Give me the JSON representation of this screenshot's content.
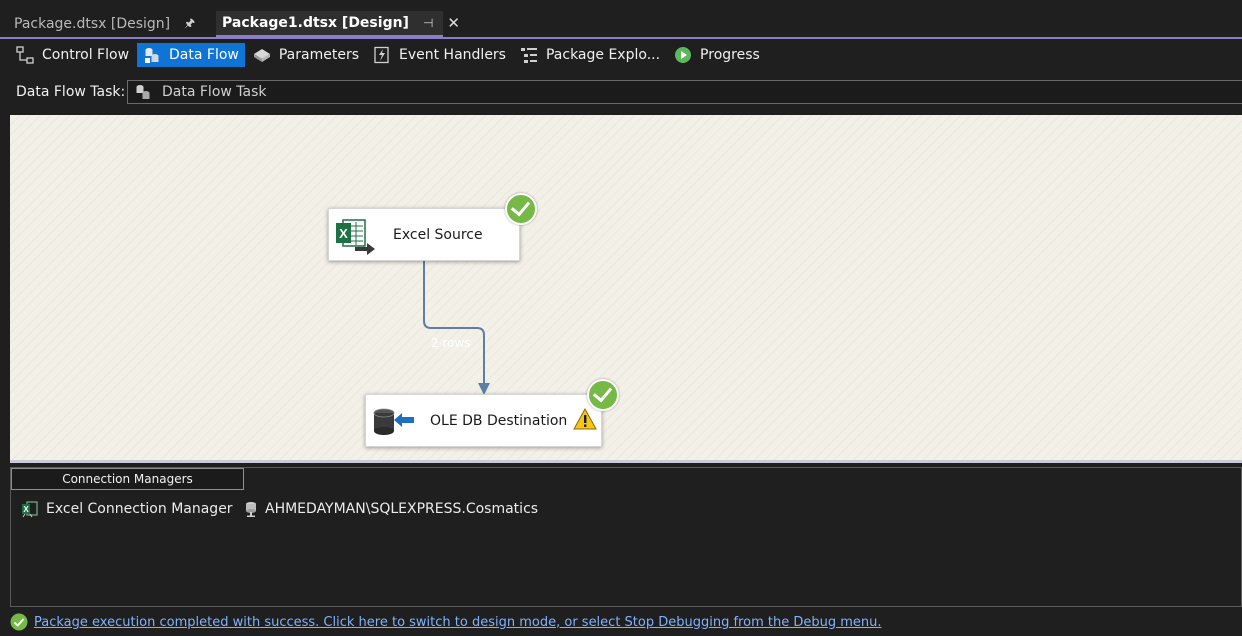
{
  "tabs": [
    {
      "label": "Package.dtsx [Design]",
      "active": false
    },
    {
      "label": "Package1.dtsx [Design]",
      "active": true
    }
  ],
  "toolbar": {
    "items": [
      {
        "label": "Control Flow",
        "icon": "control-flow-icon",
        "active": false
      },
      {
        "label": "Data Flow",
        "icon": "data-flow-icon",
        "active": true
      },
      {
        "label": "Parameters",
        "icon": "parameters-icon",
        "active": false
      },
      {
        "label": "Event Handlers",
        "icon": "event-handlers-icon",
        "active": false
      },
      {
        "label": "Package Explo...",
        "icon": "package-explorer-icon",
        "active": false
      },
      {
        "label": "Progress",
        "icon": "progress-icon",
        "active": false
      }
    ]
  },
  "task": {
    "label": "Data Flow Task:",
    "value": "Data Flow Task"
  },
  "canvas": {
    "components": [
      {
        "label": "Excel Source",
        "icon": "excel-source-icon",
        "status": "success"
      },
      {
        "label": "OLE DB Destination",
        "icon": "ole-db-destination-icon",
        "status": "success",
        "warning": true
      }
    ],
    "path_label": "2 rows"
  },
  "connection_managers": {
    "tab_label": "Connection Managers",
    "items": [
      {
        "label": "Excel Connection Manager",
        "icon": "excel-connection-icon"
      },
      {
        "label": "AHMEDAYMAN\\SQLEXPRESS.Cosmatics",
        "icon": "oledb-connection-icon"
      }
    ]
  },
  "status": {
    "text": "Package execution completed with success. Click here to switch to design mode, or select Stop Debugging from the Debug menu."
  },
  "colors": {
    "accent": "#8a7ec8",
    "active_tab": "#0f74d6",
    "success": "#76b947",
    "path": "#5b7fa6"
  }
}
